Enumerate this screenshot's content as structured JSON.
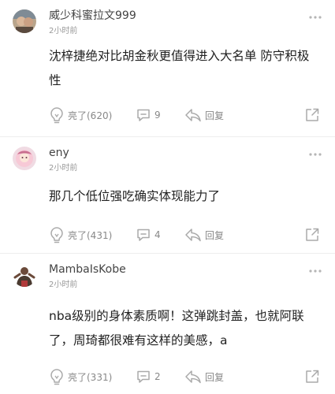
{
  "comments": [
    {
      "username": "威少科蜜拉文999",
      "time": "2小时前",
      "text": "沈梓捷绝对比胡金秋更值得进入大名单 防守积极性",
      "likes": "亮了(620)",
      "replies": "9",
      "reply_label": "回复",
      "avatar_icon": "user-avatar-icon"
    },
    {
      "username": "eny",
      "time": "2小时前",
      "text": "那几个低位强吃确实体现能力了",
      "likes": "亮了(431)",
      "replies": "4",
      "reply_label": "回复",
      "avatar_icon": "user-avatar-icon"
    },
    {
      "username": "MambaIsKobe",
      "time": "2小时前",
      "text": "nba级别的身体素质啊！这弹跳封盖，也就阿联了，周琦都很难有这样的美感，a",
      "likes": "亮了(331)",
      "replies": "2",
      "reply_label": "回复",
      "avatar_icon": "user-avatar-icon"
    }
  ],
  "colors": {
    "text": "#222222",
    "meta": "#999999",
    "icon": "#aaaaaa",
    "divider": "#eeeeee"
  }
}
